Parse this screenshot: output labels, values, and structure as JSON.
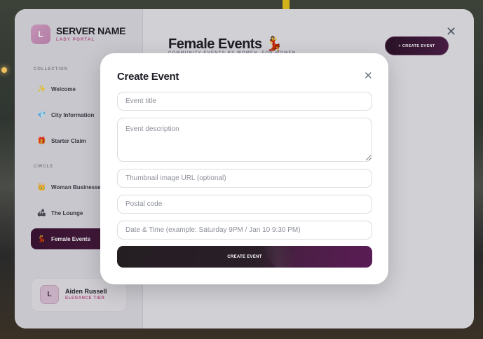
{
  "brand": {
    "logo_letter": "L",
    "name": "SERVER NAME",
    "subtitle": "LADY PORTAL"
  },
  "sidebar": {
    "sections": [
      {
        "label": "COLLECTION"
      },
      {
        "label": "CIRCLE"
      }
    ],
    "items": [
      {
        "label": "Welcome",
        "icon": "sparkle-icon",
        "glyph": "✨"
      },
      {
        "label": "City Information",
        "icon": "gem-icon",
        "glyph": "💎"
      },
      {
        "label": "Starter Claim",
        "icon": "gift-icon",
        "glyph": "🎁"
      },
      {
        "label": "Woman Businesses",
        "icon": "crown-icon",
        "glyph": "👑"
      },
      {
        "label": "The Lounge",
        "icon": "lounge-icon",
        "glyph": "🛋"
      },
      {
        "label": "Female Events",
        "icon": "dancer-icon",
        "glyph": "💃",
        "active": true
      }
    ]
  },
  "profile": {
    "avatar_letter": "L",
    "name": "Aiden Russell",
    "tier": "ELEGANCE TIER"
  },
  "page": {
    "title": "Female Events",
    "title_emoji": "💃",
    "subtitle": "COMMUNITY EVENTS BY WOMEN, FOR WOMEN",
    "create_button": "+ CREATE EVENT"
  },
  "modal": {
    "title": "Create Event",
    "fields": {
      "title": {
        "placeholder": "Event title",
        "value": ""
      },
      "description": {
        "placeholder": "Event description",
        "value": ""
      },
      "thumbnail": {
        "placeholder": "Thumbnail image URL (optional)",
        "value": ""
      },
      "postal": {
        "placeholder": "Postal code",
        "value": ""
      },
      "datetime": {
        "placeholder": "Date & Time (example: Saturday 9PM / Jan 10 9:30 PM)",
        "value": ""
      }
    },
    "submit_label": "CREATE EVENT"
  },
  "colors": {
    "accent": "#c0508a",
    "primary_dark": "#3a1030"
  }
}
